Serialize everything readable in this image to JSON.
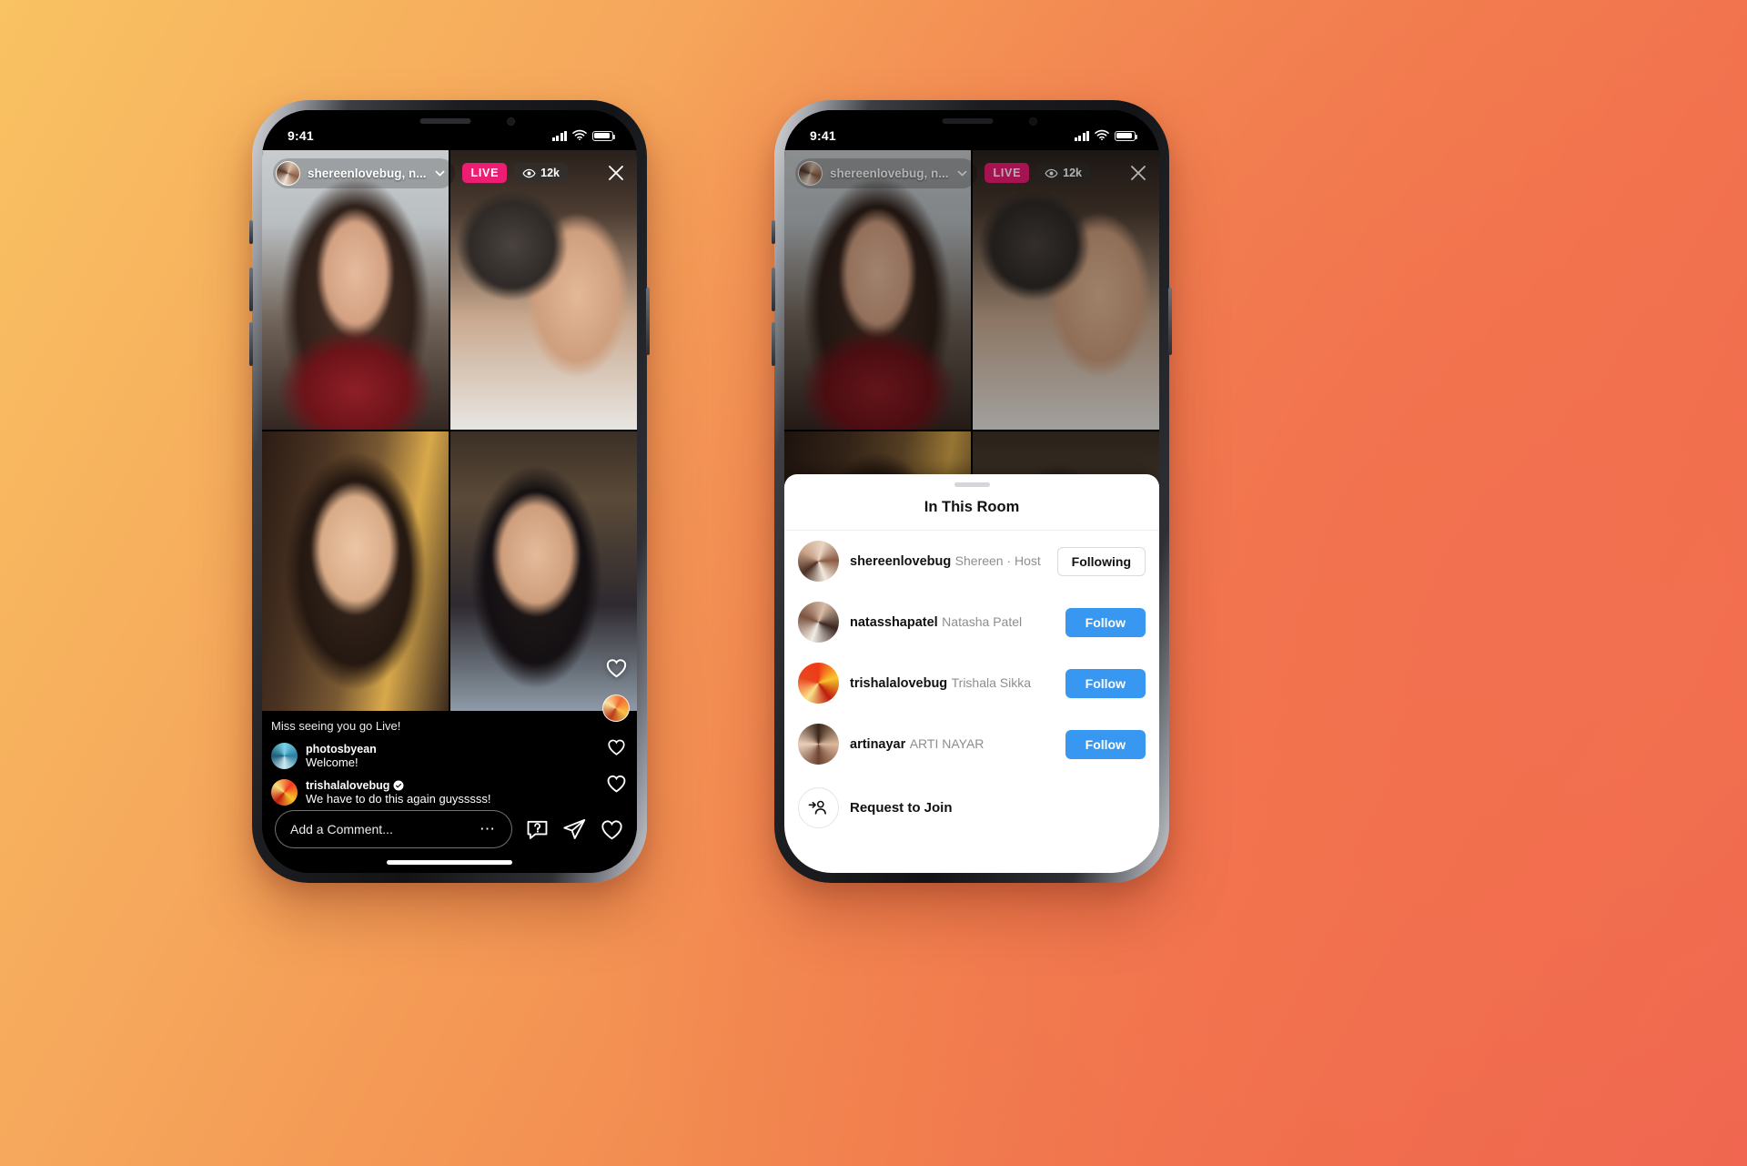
{
  "theme": {
    "background_gradient_start": "#F9C262",
    "background_gradient_mid": "#F2884F",
    "background_gradient_end": "#EE5F52",
    "live_badge_color": "#ED1D73",
    "follow_button_color": "#3897F0"
  },
  "phone_left": {
    "status_bar": {
      "time": "9:41",
      "signal_icon": "signal-bars-icon",
      "wifi_icon": "wifi-icon",
      "battery_icon": "battery-icon"
    },
    "live_header": {
      "host_avatar": "host-avatar",
      "host_label": "shereenlovebug, n...",
      "expand_icon": "chevron-down-icon",
      "live_badge": "LIVE",
      "viewers_icon": "eye-icon",
      "viewers_count": "12k",
      "close_icon": "close-icon"
    },
    "tiles": [
      {
        "name": "tile-shereenlovebug"
      },
      {
        "name": "tile-natasshapatel"
      },
      {
        "name": "tile-trishalalovebug"
      },
      {
        "name": "tile-artinayar"
      }
    ],
    "comments": [
      {
        "user": "",
        "text": "Miss seeing you go Live!",
        "avatar": "",
        "verified": false
      },
      {
        "user": "photosbyean",
        "text": "Welcome!",
        "avatar": "photosbyean-avatar",
        "verified": false
      },
      {
        "user": "trishalalovebug",
        "text": "We have to do this again guysssss!",
        "avatar": "trishalalovebug-avatar",
        "verified": true
      }
    ],
    "bottom_bar": {
      "comment_placeholder": "Add a Comment...",
      "more_icon": "ellipsis-icon",
      "question_icon": "question-sticker-icon",
      "share_icon": "paper-plane-icon",
      "like_icon": "heart-icon"
    },
    "reactions": {
      "heart_icon": "heart-icon",
      "bubble_icon": "reaction-avatar-bubble"
    }
  },
  "phone_right": {
    "status_bar": {
      "time": "9:41",
      "signal_icon": "signal-bars-icon",
      "wifi_icon": "wifi-icon",
      "battery_icon": "battery-icon"
    },
    "live_header": {
      "host_avatar": "host-avatar",
      "host_label": "shereenlovebug, n...",
      "expand_icon": "chevron-down-icon",
      "live_badge": "LIVE",
      "viewers_icon": "eye-icon",
      "viewers_count": "12k",
      "close_icon": "close-icon"
    },
    "sheet": {
      "title": "In This Room",
      "grabber": "drag-handle",
      "participants": [
        {
          "username": "shereenlovebug",
          "subtitle": "Shereen · Host",
          "action": "Following",
          "action_style": "outline",
          "avatar": "shereenlovebug-avatar"
        },
        {
          "username": "natasshapatel",
          "subtitle": "Natasha Patel",
          "action": "Follow",
          "action_style": "primary",
          "avatar": "natasshapatel-avatar"
        },
        {
          "username": "trishalalovebug",
          "subtitle": "Trishala Sikka",
          "action": "Follow",
          "action_style": "primary",
          "avatar": "trishalalovebug-avatar"
        },
        {
          "username": "artinayar",
          "subtitle": "ARTI NAYAR",
          "action": "Follow",
          "action_style": "primary",
          "avatar": "artinayar-avatar"
        }
      ],
      "request_to_join": {
        "label": "Request to Join",
        "icon": "add-person-icon"
      }
    }
  }
}
